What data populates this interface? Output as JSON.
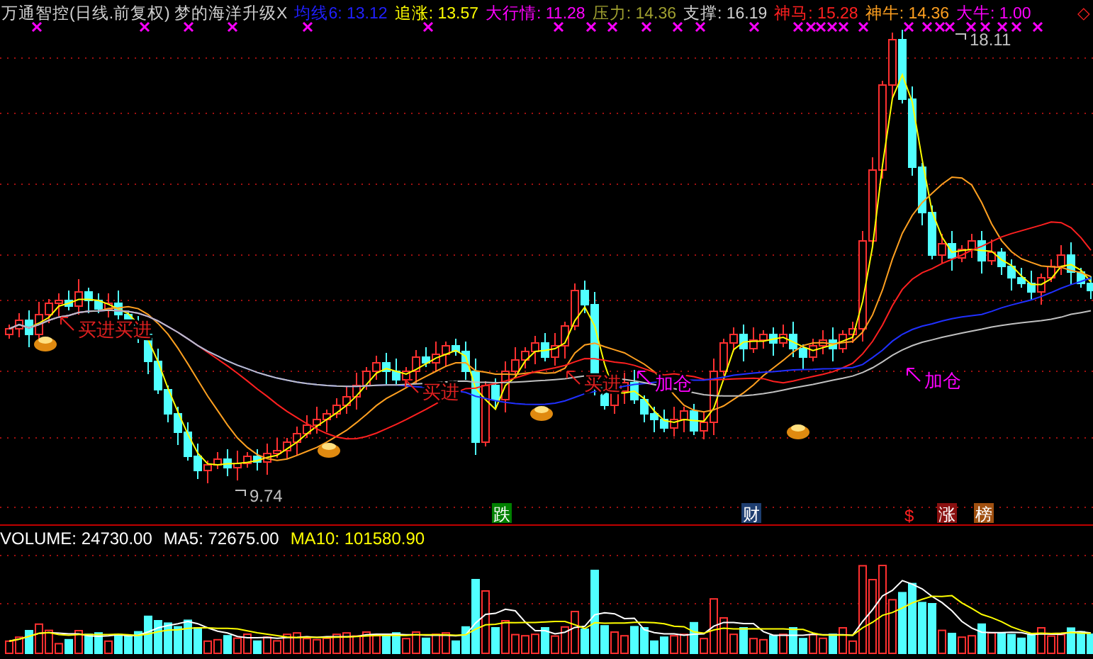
{
  "header": {
    "title": "万通智控(日线.前复权) 梦的海洋升级X",
    "indicators": [
      {
        "text": "均线6: 13.12",
        "color": "#2020ff"
      },
      {
        "text": "追涨: 13.57",
        "color": "#ffff00"
      },
      {
        "text": "大行情: 11.28",
        "color": "#ff00ff"
      },
      {
        "text": "压力: 14.36",
        "color": "#a0a030"
      },
      {
        "text": "支撑: 16.19",
        "color": "#d0d0d0"
      },
      {
        "text": "神马: 15.28",
        "color": "#ff2020"
      },
      {
        "text": "神牛: 14.36",
        "color": "#ffa020"
      },
      {
        "text": "大牛: 1.00",
        "color": "#ff00ff"
      }
    ],
    "marker": "◇"
  },
  "chart": {
    "price_labels": [
      "18.11",
      "9.74"
    ],
    "annotations": [
      {
        "text": "买进买进",
        "color": "#e02020"
      },
      {
        "text": "买进",
        "color": "#e02020"
      },
      {
        "text": "买进",
        "color": "#e02020"
      },
      {
        "text": "加仓",
        "color": "#ff00ff"
      },
      {
        "text": "加仓",
        "color": "#ff00ff"
      }
    ],
    "signals": [
      {
        "text": "跌",
        "kind": "badge",
        "color": "#008000"
      },
      {
        "text": "财",
        "kind": "badge",
        "color": "#1e3e70"
      },
      {
        "text": "$",
        "kind": "plain",
        "color": "#ff2020"
      },
      {
        "text": "涨",
        "kind": "badge",
        "color": "#8a1010"
      },
      {
        "text": "榜",
        "kind": "badge",
        "color": "#a05010"
      }
    ]
  },
  "volume": {
    "indicators": [
      {
        "text": "VOLUME: 24730.00",
        "color": "#ffffff"
      },
      {
        "text": "MA5: 72675.00",
        "color": "#ffffff"
      },
      {
        "text": "MA10: 101580.90",
        "color": "#ffff00"
      }
    ]
  }
}
